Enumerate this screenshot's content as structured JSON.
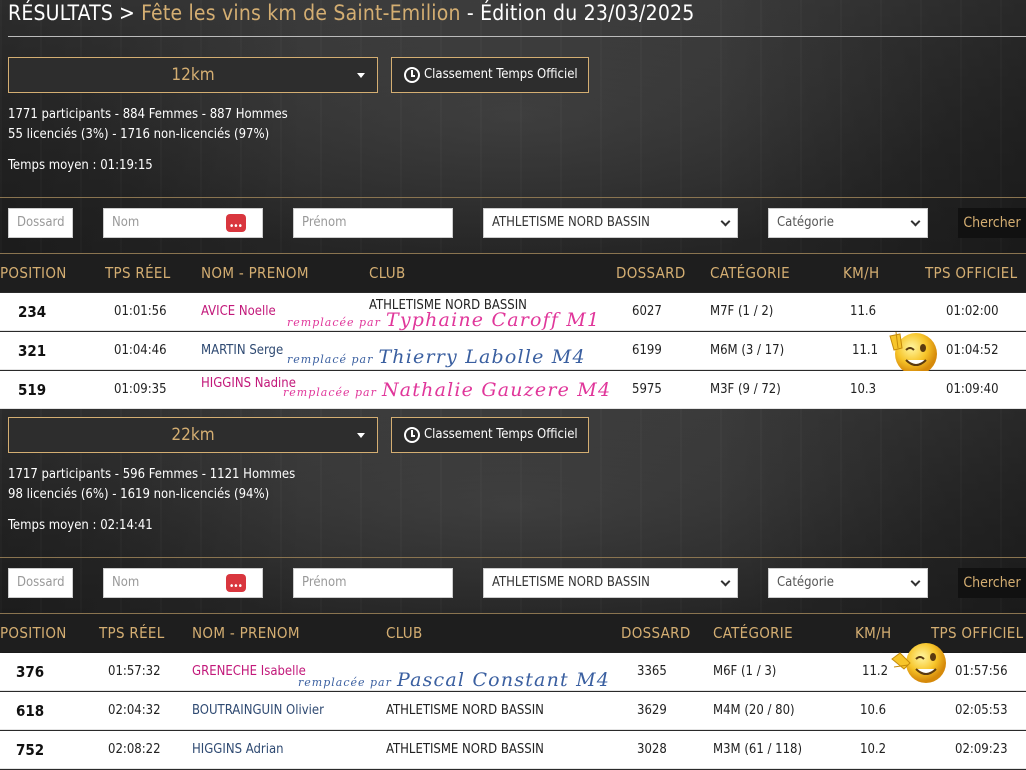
{
  "header": {
    "results": "RÉSULTATS",
    "separator": ">",
    "event": "Fête les vins km de Saint-Emilion",
    "edition": " - Édition du 23/03/2025"
  },
  "sections": [
    {
      "distance": "12km",
      "classement": "Classement Temps Officiel",
      "stats": {
        "participants": "1771 participants - 884 Femmes - 887 Hommes",
        "licences": "55 licenciés (3%) - 1716 non-licenciés (97%)",
        "temps_moyen": "Temps moyen : 01:19:15"
      },
      "filters": {
        "dossard": "Dossard",
        "nom": "Nom",
        "prenom": "Prénom",
        "club": "ATHLETISME NORD BASSIN",
        "categorie": "Catégorie",
        "search": "Chercher"
      },
      "headers": [
        "POSITION",
        "TPS RÉEL",
        "NOM - PRENOM",
        "CLUB",
        "DOSSARD",
        "CATÉGORIE",
        "KM/H",
        "TPS OFFICIEL"
      ],
      "rows": [
        {
          "position": "234",
          "tps_reel": "01:01:56",
          "nom": "AVICE Noelle",
          "club": "ATHLETISME NORD BASSIN",
          "dossard": "6027",
          "categorie": "M7F (1 / 2)",
          "kmh": "11.6",
          "tps_officiel": "01:02:00",
          "note_prefix": "remplacée par",
          "note_name": "Typhaine Caroff M1"
        },
        {
          "position": "321",
          "tps_reel": "01:04:46",
          "nom": "MARTIN Serge",
          "club": "",
          "dossard": "6199",
          "categorie": "M6M (3 / 17)",
          "kmh": "11.1",
          "tps_officiel": "01:04:52",
          "note_prefix": "remplacé par",
          "note_name": "Thierry Labolle M4"
        },
        {
          "position": "519",
          "tps_reel": "01:09:35",
          "nom": "HIGGINS Nadine",
          "club": "",
          "dossard": "5975",
          "categorie": "M3F (9 / 72)",
          "kmh": "10.3",
          "tps_officiel": "01:09:40",
          "note_prefix": "remplacée par",
          "note_name": "Nathalie Gauzere M4"
        }
      ]
    },
    {
      "distance": "22km",
      "classement": "Classement Temps Officiel",
      "stats": {
        "participants": "1717 participants - 596 Femmes - 1121 Hommes",
        "licences": "98 licenciés (6%) - 1619 non-licenciés (94%)",
        "temps_moyen": "Temps moyen : 02:14:41"
      },
      "filters": {
        "dossard": "Dossard",
        "nom": "Nom",
        "prenom": "Prénom",
        "club": "ATHLETISME NORD BASSIN",
        "categorie": "Catégorie",
        "search": "Chercher"
      },
      "headers": [
        "POSITION",
        "TPS RÉEL",
        "NOM - PRENOM",
        "CLUB",
        "DOSSARD",
        "CATÉGORIE",
        "KM/H",
        "TPS OFFICIEL"
      ],
      "rows": [
        {
          "position": "376",
          "tps_reel": "01:57:32",
          "nom": "GRENECHE Isabelle",
          "club": "",
          "dossard": "3365",
          "categorie": "M6F (1 / 3)",
          "kmh": "11.2",
          "tps_officiel": "01:57:56",
          "note_prefix": "remplacée par",
          "note_name": "Pascal Constant M4"
        },
        {
          "position": "618",
          "tps_reel": "02:04:32",
          "nom": "BOUTRAINGUIN Olivier",
          "club": "ATHLETISME NORD BASSIN",
          "dossard": "3629",
          "categorie": "M4M (20 / 80)",
          "kmh": "10.6",
          "tps_officiel": "02:05:53"
        },
        {
          "position": "752",
          "tps_reel": "02:08:22",
          "nom": "HIGGINS Adrian",
          "club": "ATHLETISME NORD BASSIN",
          "dossard": "3028",
          "categorie": "M3M (61 / 118)",
          "kmh": "10.2",
          "tps_officiel": "02:09:23"
        }
      ]
    }
  ],
  "icons": {
    "emoji": "winking-smiley-peace-sign"
  },
  "colors": {
    "gold": "#d4ae72",
    "pink_name": "#c2187a",
    "blue_name": "#2f4a72",
    "pink_handwriting": "#e0369a",
    "blue_handwriting": "#3a5fa0",
    "search_red": "#d9363e"
  }
}
